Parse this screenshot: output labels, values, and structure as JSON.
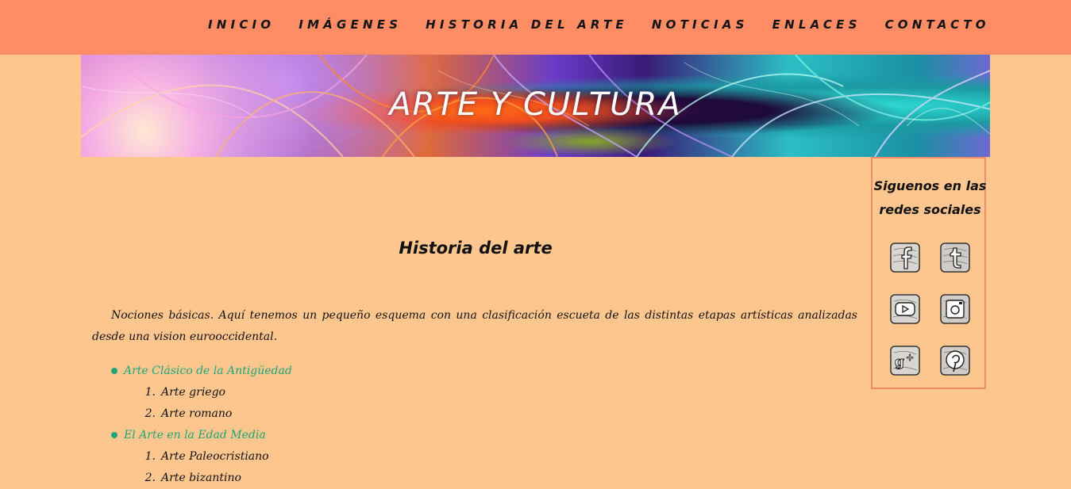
{
  "nav": {
    "items": [
      "INICIO",
      "IMÁGENES",
      "HISTORIA DEL ARTE",
      "NOTICIAS",
      "ENLACES",
      "CONTACTO"
    ]
  },
  "banner": {
    "title": "ARTE Y CULTURA"
  },
  "main": {
    "title": "Historia del arte",
    "intro": "Nociones básicas. Aquí tenemos un pequeño esquema con una clasificación escueta de las distintas etapas artísticas analizadas desde una vision eurooccidental.",
    "outline": [
      {
        "label": "Arte Clásico de la Antigüedad",
        "items": [
          "Arte griego",
          "Arte romano"
        ]
      },
      {
        "label": "El Arte en la Edad Media",
        "items": [
          "Arte Paleocristiano",
          "Arte bizantino"
        ]
      }
    ],
    "link_color": "#21a577"
  },
  "social": {
    "title": "Siguenos en las redes sociales",
    "icons": [
      "facebook-icon",
      "tumblr-icon",
      "youtube-icon",
      "instagram-icon",
      "google-plus-icon",
      "pinterest-icon"
    ],
    "border_color": "#f18c68"
  },
  "colors": {
    "background": "#fec68f",
    "nav_bar": "#fe8c64"
  }
}
